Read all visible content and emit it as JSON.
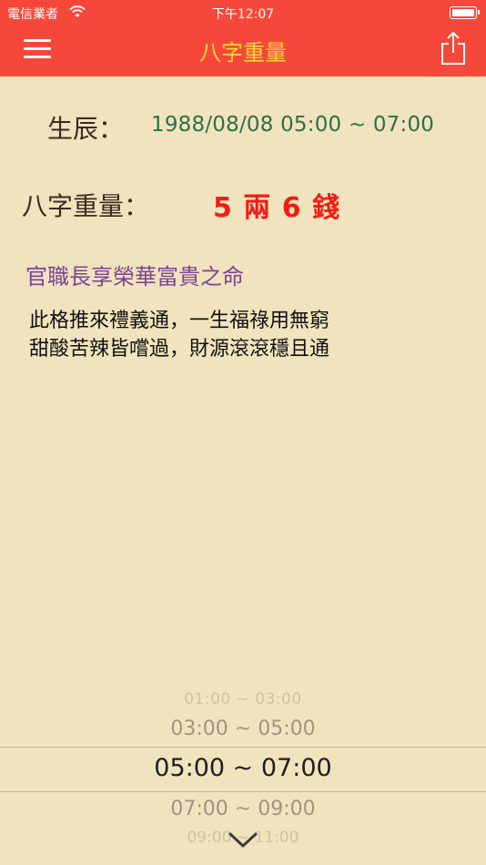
{
  "status_bar": {
    "carrier": "電信業者",
    "time": "下午12:07"
  },
  "nav": {
    "title": "八字重量"
  },
  "birth": {
    "label": "生辰：",
    "value": "1988/08/08   05:00 ~ 07:00"
  },
  "weight": {
    "label": "八字重量：",
    "value": "5 兩 6 錢"
  },
  "fate": {
    "title": "官職長享榮華富貴之命"
  },
  "poem": {
    "line1": "此格推來禮義通，一生福祿用無窮",
    "line2": "甜酸苦辣皆嚐過，財源滾滾穩且通"
  },
  "picker": {
    "options": [
      "01:00 ~ 03:00",
      "03:00 ~ 05:00",
      "05:00 ~ 07:00",
      "07:00 ~ 09:00",
      "09:00 ~ 11:00"
    ],
    "selected": "05:00 ~ 07:00"
  },
  "colors": {
    "nav_background": "#f6483a",
    "nav_title": "#ffd83a",
    "page_background": "#f1e3bd",
    "birth_value": "#2f6f45",
    "weight_value": "#f21c15",
    "fate_title": "#7b4596"
  },
  "icons": {
    "menu": "hamburger-icon",
    "share": "share-icon",
    "wifi": "wifi-icon",
    "battery": "battery-icon",
    "picker_toggle": "chevron-down-icon"
  }
}
